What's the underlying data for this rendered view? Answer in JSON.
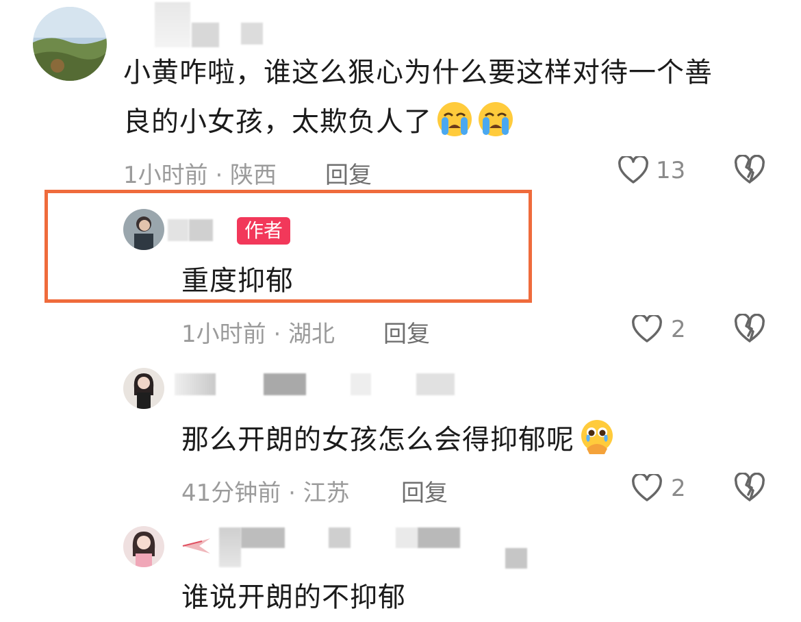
{
  "comments": [
    {
      "text_line1": "小黄咋啦，谁这么狠心为什么要这样对待一个善",
      "text_line2": "良的小女孩，太欺负人了",
      "meta": "1小时前 · 陕西",
      "reply_label": "回复",
      "likes": "13",
      "emojis": [
        "loudly-crying-face",
        "loudly-crying-face"
      ]
    },
    {
      "badge": "作者",
      "text": "重度抑郁",
      "meta": "1小时前 · 湖北",
      "reply_label": "回复",
      "likes": "2"
    },
    {
      "text": "那么开朗的女孩怎么会得抑郁呢",
      "meta": "41分钟前 · 江苏",
      "reply_label": "回复",
      "likes": "2",
      "emojis": [
        "face-holding-back-tears"
      ]
    },
    {
      "text": "谁说开朗的不抑郁"
    }
  ],
  "colors": {
    "highlight_border": "#ef6b3c",
    "author_badge": "#f2385a"
  }
}
